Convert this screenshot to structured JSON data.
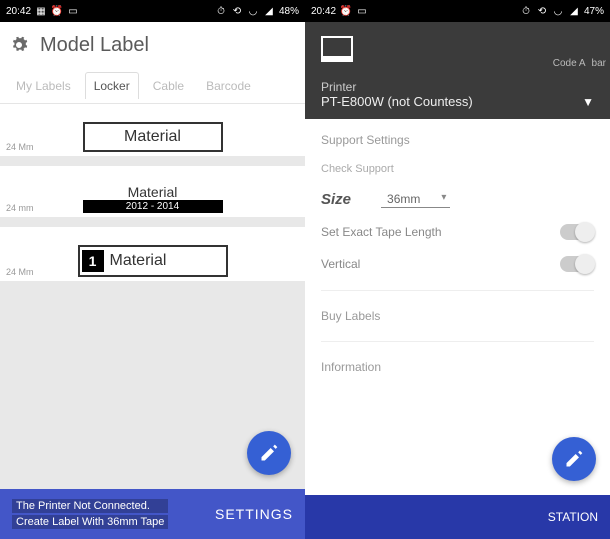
{
  "statusbar": {
    "time": "20:42",
    "battery_left": "48%",
    "battery_right": "47%"
  },
  "left": {
    "title": "Model Label",
    "tabs": {
      "mylabels": "My Labels",
      "locker": "Locker",
      "cable": "Cable",
      "barcode": "Barcode"
    },
    "labels": {
      "row1_text": "Material",
      "row1_size": "24 Mm",
      "row2_line1": "Material",
      "row2_line2": "2012 - 2014",
      "row2_size": "24 mm",
      "row3_num": "1",
      "row3_text": "Material",
      "row3_size": "24 Mm"
    },
    "footer": {
      "line1": "The Printer Not Connected.",
      "line2": "Create Label With 36mm Tape",
      "settings": "SETTINGS"
    }
  },
  "right": {
    "printer_label": "Printer",
    "printer_value": "PT-E800W (not Countess)",
    "support_settings": "Support Settings",
    "check_support": "Check Support",
    "size_label": "Size",
    "size_value": "36mm",
    "exact_length": "Set Exact Tape Length",
    "vertical": "Vertical",
    "buy_labels": "Buy Labels",
    "information": "Information",
    "peek_tab1": "Code A",
    "peek_tab2": "bar",
    "bottom_btn": "STATION"
  }
}
